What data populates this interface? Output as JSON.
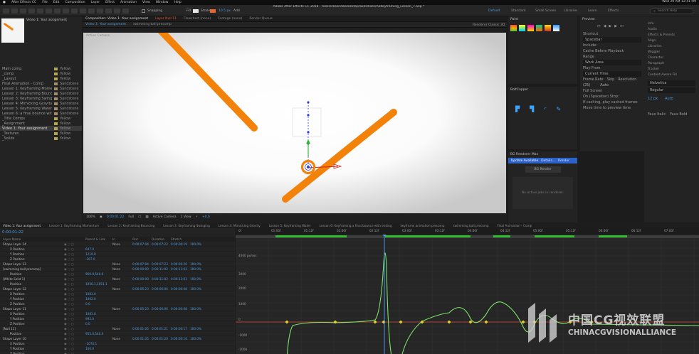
{
  "menubar": {
    "app": "After Effects CC",
    "items": [
      "File",
      "Edit",
      "Composition",
      "Layer",
      "Effect",
      "Animation",
      "View",
      "Window",
      "Help"
    ],
    "clock": "Wed 29 AM  12:41 PM"
  },
  "toolbar": {
    "window_title": "Adobe After Effects CC 2018 - /Users/kalinda/Desktop/Skillshare/AeKeyframing_Lesson_7.aep *",
    "snapping": "Snapping",
    "fill": "Fill",
    "stroke": "Stroke",
    "stroke_width": "10.5 px",
    "add": "Add",
    "workspaces": [
      "Default",
      "Standard",
      "Small Screen",
      "Libraries",
      "Learn",
      "Effects"
    ],
    "search_placeholder": "Search Help"
  },
  "project": {
    "preview_name": "Video 1: Your assignment",
    "rows": [
      {
        "name": "Main comp",
        "type": "Yellow"
      },
      {
        "name": "_comp",
        "type": "Yellow"
      },
      {
        "name": "_Layout",
        "type": "Yellow"
      },
      {
        "name": "Final Animation - Comp",
        "type": "Sandstone"
      },
      {
        "name": "Lesson 1: Keyframing Momentum",
        "type": "Sandstone"
      },
      {
        "name": "Lesson 2: Keyframing Bouncing",
        "type": "Sandstone"
      },
      {
        "name": "Lesson 3: Keyframing Swinging",
        "type": "Sandstone"
      },
      {
        "name": "Lesson 4: Mimicking Gravity",
        "type": "Sandstone"
      },
      {
        "name": "Lesson 5: Keyframing Water",
        "type": "Sandstone"
      },
      {
        "name": "Lesson 6: a final bounce with ending",
        "type": "Sandstone"
      },
      {
        "name": "_Title Comps",
        "type": "Yellow"
      },
      {
        "name": "_Assignment",
        "type": "Yellow"
      },
      {
        "name": "Video 1: Your assignment",
        "type": "Yellow"
      },
      {
        "name": "_Textures",
        "type": "Yellow"
      },
      {
        "name": "_Solids",
        "type": "Yellow"
      }
    ]
  },
  "comp_tabs": {
    "tabs": [
      "Composition: Video 1: Your assignment",
      "Layer Null 11",
      "Flowchart (none)",
      "Footage (none)",
      "Render Queue"
    ],
    "breadcrumb": [
      "Video 1: Your assignment",
      "swimming ball precomp"
    ],
    "renderer": "Renderer:",
    "renderer_value": "Classic 3D",
    "label": "Active Camera"
  },
  "viewer_controls": {
    "zoom": "100%",
    "time": "0:00:01:22",
    "resolution": "Full",
    "camera": "Active Camera",
    "views": "1 View",
    "exposure": "+0.0"
  },
  "right_panels": {
    "paint": "Paint",
    "boltcapper": "BoltCapper",
    "bg_renderer": "BG Renderer Max",
    "update": "Update Available",
    "details": "Details...",
    "render": "Render",
    "bg_render_button": "BG Render",
    "no_jobs": "No active jobs in renderer.",
    "preview": "Preview",
    "shortcut": "Shortcut",
    "spacebar": "Spacebar",
    "include": "Include:",
    "cache_before": "Cache Before Playback",
    "range": "Range",
    "work_area": "Work Area",
    "play_from": "Play From",
    "current_time": "Current Time",
    "frame_rate": "Frame Rate",
    "skip": "Skip",
    "resolution": "Resolution",
    "fr_value": "(25)",
    "res_value": "Auto",
    "full_screen": "Full Screen",
    "on_stop": "On (Spacebar) Stop:",
    "if_caching": "If caching, play cached frames",
    "move_time": "Move time to preview time"
  },
  "far_right": [
    "Info",
    "Audio",
    "Effects & Presets",
    "Align",
    "Libraries",
    "Wiggler",
    "Character",
    "Paragraph",
    "Tracker",
    "Content-Aware Fill"
  ],
  "character": {
    "font": "Helvetica",
    "style": "Regular",
    "size": "12 px",
    "leading": "Auto",
    "faux_italic": "Faux Italic",
    "faux_bold": "Faux Bold"
  },
  "timeline": {
    "tabs": [
      "Video 1: Your assignment",
      "Lesson 1: Keyframing Momentum",
      "Lesson 2: Keyframing Bouncing",
      "Lesson 3: Keyframing Swinging",
      "Lesson 4: Mimicking Gravity",
      "Lesson 5: Keyframing Water",
      "Lesson 6: Keyframing a final bounce with ending",
      "keyframe animation precomp",
      "swimming ball precomp",
      "Final Animation - Comp"
    ],
    "current_time": "0:00:01:22",
    "headers": [
      "Layer Name",
      "Parent & Link",
      "In",
      "Out",
      "Duration",
      "Stretch"
    ],
    "rows": [
      {
        "name": "Shape Layer 14",
        "parent": "None",
        "in": "0:00:07:04",
        "out": "0:00:07:22",
        "dur": "0:00:00:19",
        "stretch": "100.0%"
      },
      {
        "name": "X Position",
        "value": "647.0"
      },
      {
        "name": "Y Position",
        "value": "1219.0"
      },
      {
        "name": "Z Position",
        "value": "-397.0"
      },
      {
        "name": "Shape Layer 13",
        "parent": "None",
        "in": "0:00:07:04",
        "out": "0:00:07:23",
        "dur": "0:00:00:20",
        "stretch": "100.0%"
      },
      {
        "name": "[swimming ball precomp]",
        "parent": "None",
        "in": "0:00:00:00",
        "out": "0:00:11:02",
        "dur": "0:00:11:03",
        "stretch": "100.0%"
      },
      {
        "name": "Position",
        "value": "960.0,540.0"
      },
      {
        "name": "[White Solid 1]",
        "parent": "None",
        "in": "0:00:00:00",
        "out": "0:00:11:02",
        "dur": "0:00:11:03",
        "stretch": "100.0%"
      },
      {
        "name": "Position",
        "value": "1056.1,1051.1"
      },
      {
        "name": "Shape Layer 12",
        "parent": "None",
        "in": "0:00:05:23",
        "out": "0:00:06:06",
        "dur": "0:00:00:08",
        "stretch": "100.0%"
      },
      {
        "name": "X Position",
        "value": "1081.0"
      },
      {
        "name": "Y Position",
        "value": "1002.0"
      },
      {
        "name": "Z Position",
        "value": "0.0"
      },
      {
        "name": "Shape Layer 11",
        "parent": "None",
        "in": "0:00:05:23",
        "out": "0:00:06:06",
        "dur": "0:00:00:08",
        "stretch": "100.0%"
      },
      {
        "name": "X Position",
        "value": "1081.0"
      },
      {
        "name": "Y Position",
        "value": "992.0"
      },
      {
        "name": "Z Position",
        "value": "0.0"
      },
      {
        "name": "[Null 11]",
        "parent": "None",
        "in": "0:00:01:05",
        "out": "0:00:01:21",
        "dur": "0:00:00:17",
        "stretch": "100.0%"
      },
      {
        "name": "Position",
        "value": "955.0,540.0"
      },
      {
        "name": "Shape Layer 10",
        "parent": "None",
        "in": "0:00:01:05",
        "out": "0:00:01:20",
        "dur": "0:00:00:16",
        "stretch": "100.0%"
      },
      {
        "name": "X Position",
        "value": "-1070.1"
      },
      {
        "name": "Y Position",
        "value": "100.0"
      },
      {
        "name": "Z Position",
        "value": ""
      },
      {
        "name": "Shape Layer 9",
        "parent": "None",
        "in": "0:00:00:00",
        "out": "0:00:01:00",
        "dur": "0:00:01:01",
        "stretch": "100.0%"
      }
    ],
    "ruler": [
      "0f",
      "01:00f",
      "01:12f",
      "02:00f",
      "02:12f",
      "03:00f",
      "03:12f",
      "04:00f",
      "04:12f",
      "05:00f",
      "05:12f",
      "06:00f",
      "06:12f",
      "07:00f"
    ],
    "y_unit": "4000 px/sec",
    "y_ticks": [
      "3000",
      "2000",
      "1000",
      "0",
      "-1000",
      "-2000"
    ]
  },
  "watermark": {
    "cn": "中国CG视效联盟",
    "en": "CHINACGVISIONALLIANCE"
  },
  "colors": {
    "accent": "#2d8ceb",
    "stick": "#f2820a",
    "graph": "#7de36a",
    "keyframe": "#e0d22a",
    "playhead": "#4aa3ff"
  }
}
